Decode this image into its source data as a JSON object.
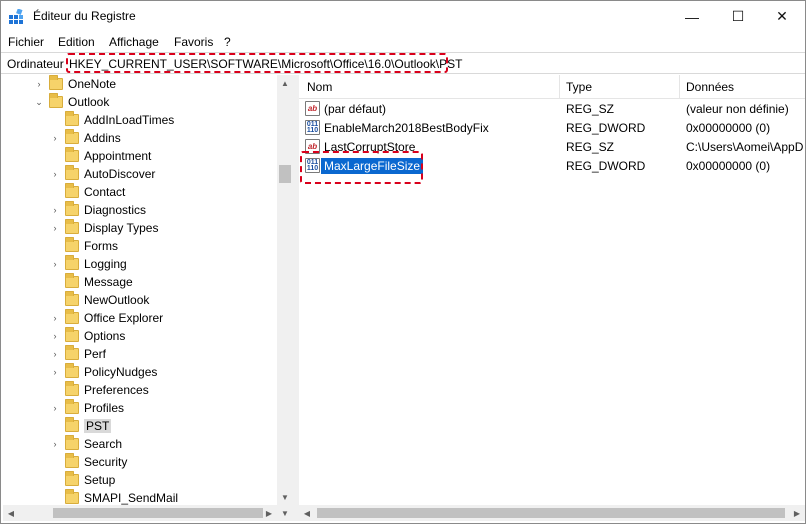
{
  "window": {
    "title": "Éditeur du Registre",
    "controls": {
      "minimize": "—",
      "maximize": "☐",
      "close": "✕"
    },
    "app_icon": "registry-editor-icon"
  },
  "menu": {
    "items": [
      "Fichier",
      "Edition",
      "Affichage",
      "Favoris",
      "?"
    ]
  },
  "address": {
    "root_label": "Ordinateur",
    "path": "HKEY_CURRENT_USER\\SOFTWARE\\Microsoft\\Office\\16.0\\Outlook\\PST",
    "highlight_color": "#d9001b"
  },
  "tree": {
    "items": [
      {
        "label": "OneNote",
        "chevron": "›",
        "expanded": false
      },
      {
        "label": "Outlook",
        "chevron": "⌄",
        "expanded": true
      },
      {
        "label": "AddInLoadTimes",
        "chevron": ""
      },
      {
        "label": "Addins",
        "chevron": "›"
      },
      {
        "label": "Appointment",
        "chevron": ""
      },
      {
        "label": "AutoDiscover",
        "chevron": "›"
      },
      {
        "label": "Contact",
        "chevron": ""
      },
      {
        "label": "Diagnostics",
        "chevron": "›"
      },
      {
        "label": "Display Types",
        "chevron": "›"
      },
      {
        "label": "Forms",
        "chevron": ""
      },
      {
        "label": "Logging",
        "chevron": "›"
      },
      {
        "label": "Message",
        "chevron": ""
      },
      {
        "label": "NewOutlook",
        "chevron": ""
      },
      {
        "label": "Office Explorer",
        "chevron": "›"
      },
      {
        "label": "Options",
        "chevron": "›"
      },
      {
        "label": "Perf",
        "chevron": "›"
      },
      {
        "label": "PolicyNudges",
        "chevron": "›"
      },
      {
        "label": "Preferences",
        "chevron": ""
      },
      {
        "label": "Profiles",
        "chevron": "›"
      },
      {
        "label": "PST",
        "chevron": "",
        "selected": true
      },
      {
        "label": "Search",
        "chevron": "›"
      },
      {
        "label": "Security",
        "chevron": ""
      },
      {
        "label": "Setup",
        "chevron": ""
      },
      {
        "label": "SMAPI_SendMail",
        "chevron": ""
      }
    ]
  },
  "list": {
    "columns": {
      "name": "Nom",
      "type": "Type",
      "data": "Données"
    },
    "rows": [
      {
        "icon": "ab",
        "kind": "string-value-icon",
        "name": "(par défaut)",
        "type": "REG_SZ",
        "data": "(valeur non définie)"
      },
      {
        "icon": "011\n110",
        "kind": "dword-value-icon",
        "name": "EnableMarch2018BestBodyFix",
        "type": "REG_DWORD",
        "data": "0x00000000 (0)"
      },
      {
        "icon": "ab",
        "kind": "string-value-icon",
        "name": "LastCorruptStore",
        "type": "REG_SZ",
        "data": "C:\\Users\\Aomei\\AppD"
      },
      {
        "icon": "011\n110",
        "kind": "dword-value-icon",
        "name": "MaxLargeFileSize",
        "type": "REG_DWORD",
        "data": "0x00000000 (0)",
        "selected": true
      }
    ]
  },
  "colors": {
    "selection": "#0a68d0",
    "highlight_dash": "#d9001b",
    "folder": "#f6d36a"
  }
}
